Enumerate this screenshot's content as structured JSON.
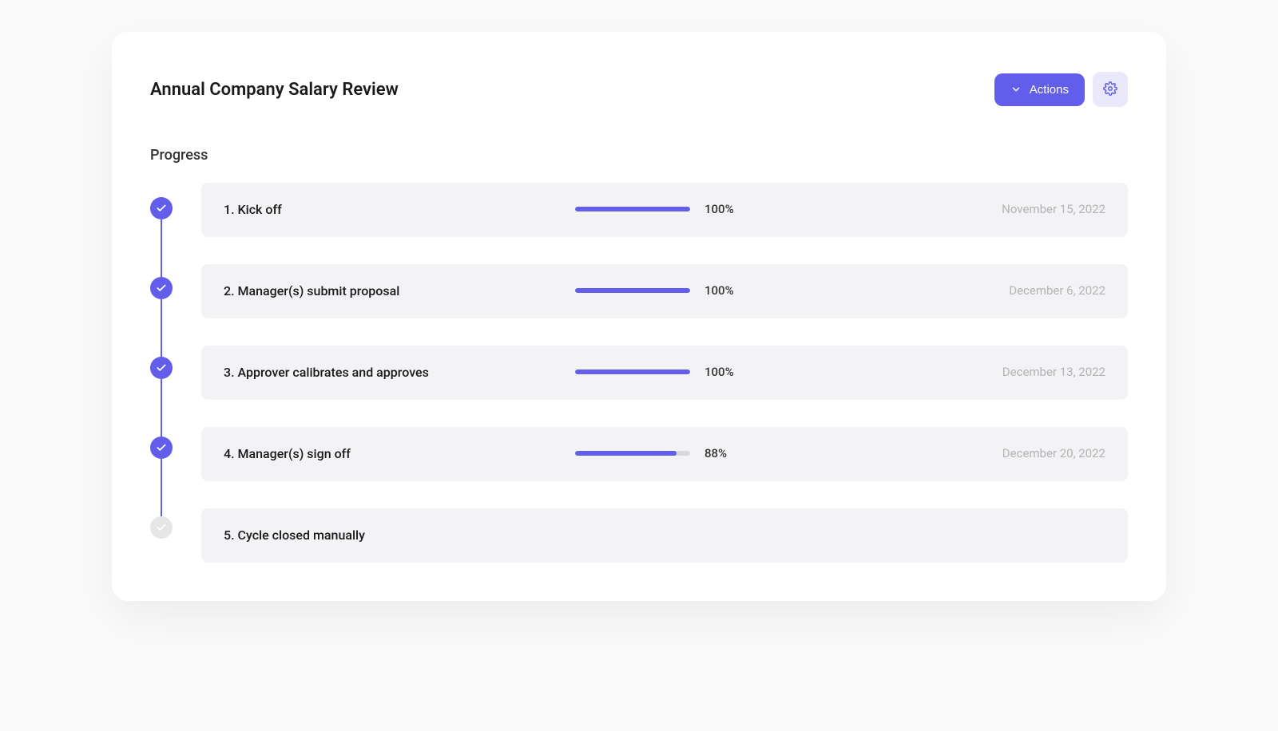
{
  "header": {
    "title": "Annual Company Salary Review",
    "actions_label": "Actions"
  },
  "section_title": "Progress",
  "colors": {
    "accent": "#625dea",
    "bg_light": "#f3f3f6",
    "settings_bg": "#e9e9fb"
  },
  "steps": [
    {
      "label": "1. Kick off",
      "percent": 100,
      "percent_text": "100%",
      "date": "November 15, 2022",
      "complete": true,
      "has_progress": true
    },
    {
      "label": "2. Manager(s) submit proposal",
      "percent": 100,
      "percent_text": "100%",
      "date": "December 6, 2022",
      "complete": true,
      "has_progress": true
    },
    {
      "label": "3. Approver calibrates and approves",
      "percent": 100,
      "percent_text": "100%",
      "date": "December 13, 2022",
      "complete": true,
      "has_progress": true
    },
    {
      "label": "4. Manager(s) sign off",
      "percent": 88,
      "percent_text": "88%",
      "date": "December 20, 2022",
      "complete": true,
      "has_progress": true
    },
    {
      "label": "5. Cycle closed manually",
      "percent": 0,
      "percent_text": "",
      "date": "",
      "complete": false,
      "has_progress": false
    }
  ]
}
